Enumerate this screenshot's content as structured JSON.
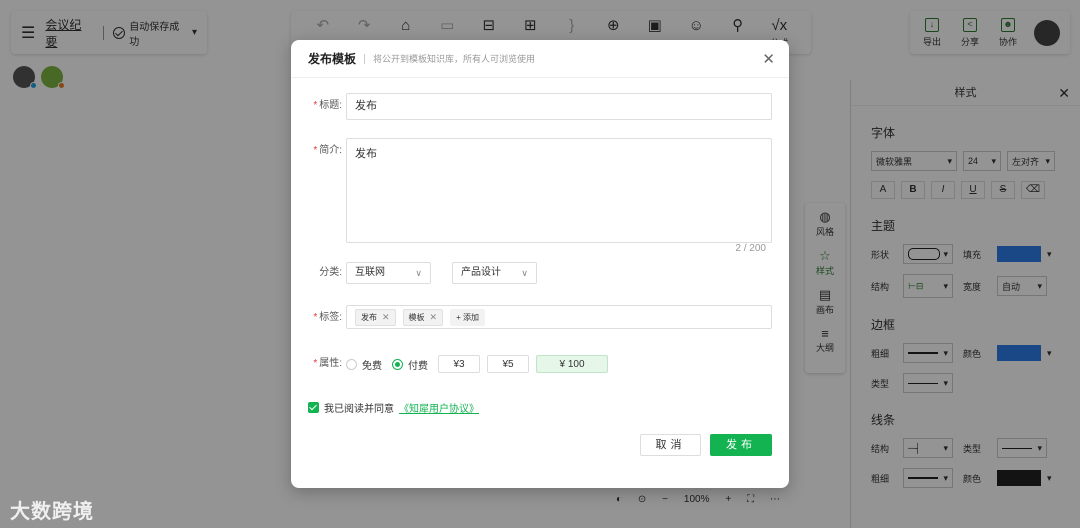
{
  "doc": {
    "title": "会议纪要",
    "save_status": "自动保存成功"
  },
  "toolbar": {
    "items": [
      {
        "label": "",
        "icon": "undo-icon"
      },
      {
        "label": "",
        "icon": "redo-icon"
      },
      {
        "label": "",
        "icon": "basket-icon"
      },
      {
        "label": "",
        "icon": "node-icon"
      },
      {
        "label": "",
        "icon": "subtopic-icon"
      },
      {
        "label": "",
        "icon": "relation-icon"
      },
      {
        "label": "",
        "icon": "summary-icon"
      },
      {
        "label": "",
        "icon": "note-icon"
      },
      {
        "label": "",
        "icon": "image-icon"
      },
      {
        "label": "",
        "icon": "emoji-icon"
      },
      {
        "label": "",
        "icon": "link-icon"
      },
      {
        "label": "公式",
        "icon": "formula-icon"
      }
    ]
  },
  "topright": {
    "export": "导出",
    "share": "分享",
    "collab": "协作"
  },
  "side_strip": {
    "style_theme": "风格",
    "style": "样式",
    "canvas": "画布",
    "outline": "大纲"
  },
  "right_panel": {
    "title": "样式",
    "font_title": "字体",
    "font_family": "微软雅黑",
    "font_size": "24",
    "align": "左对齐",
    "theme_title": "主题",
    "shape_label": "形状",
    "fill_label": "填充",
    "structure_label": "结构",
    "width_label": "宽度",
    "width_value": "自动",
    "border_title": "边框",
    "thickness_label": "粗细",
    "color_label": "颜色",
    "type_label": "类型",
    "line_title": "线条",
    "line_structure_label": "结构",
    "line_type_label": "类型",
    "line_thickness_label": "粗细",
    "line_color_label": "颜色",
    "colors": {
      "fill": "#2d7be5",
      "border": "#2d7be5",
      "line": "#222222"
    }
  },
  "zoom": {
    "level": "100%"
  },
  "watermark": "大数跨境",
  "dialog": {
    "title": "发布模板",
    "subtitle": "将公开到模板知识库，所有人可浏览使用",
    "title_label": "标题:",
    "title_value": "发布",
    "intro_label": "简介:",
    "intro_value": "发布",
    "counter": "2 / 200",
    "category_label": "分类:",
    "category_1": "互联网",
    "category_2": "产品设计",
    "tags_label": "标签:",
    "tags": [
      "发布",
      "模板"
    ],
    "add_tag": "+ 添加",
    "attr_label": "属性:",
    "free": "免费",
    "paid": "付费",
    "prices": [
      "¥3",
      "¥5"
    ],
    "price_selected": "¥  100",
    "agree_text": "我已阅读并同意",
    "agree_link": "《知犀用户协议》",
    "cancel": "取消",
    "publish": "发布",
    "accent": "#13b352"
  }
}
